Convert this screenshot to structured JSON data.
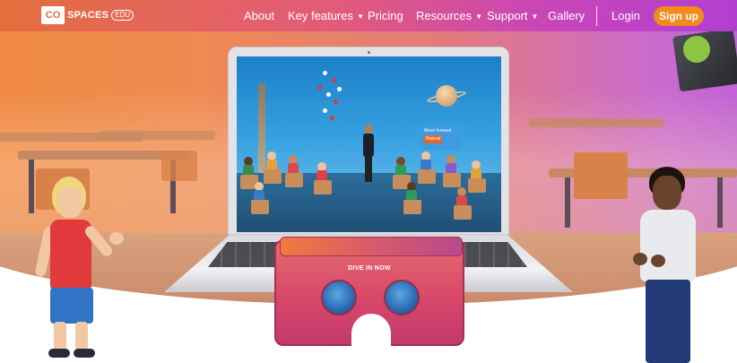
{
  "brand": {
    "logo_badge": "CO",
    "logo_text": "SPACES",
    "logo_edu": "EDU"
  },
  "nav": {
    "items": [
      {
        "label": "About",
        "has_dropdown": false
      },
      {
        "label": "Key features",
        "has_dropdown": true
      },
      {
        "label": "Pricing",
        "has_dropdown": false
      },
      {
        "label": "Resources",
        "has_dropdown": true
      },
      {
        "label": "Support",
        "has_dropdown": true
      },
      {
        "label": "Gallery",
        "has_dropdown": false
      }
    ],
    "login_label": "Login",
    "signup_label": "Sign up"
  },
  "hero": {
    "vr_label": "DIVE IN NOW",
    "screen_sign": {
      "line1": "Move forward",
      "line2": "Repeat"
    }
  },
  "colors": {
    "nav_gradient_start": "#e46f3d",
    "nav_gradient_end": "#b13fd0",
    "signup_button": "#f28a1e",
    "vr_viewer": "#d9486a"
  }
}
